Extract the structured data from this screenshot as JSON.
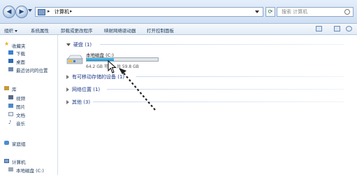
{
  "address": {
    "crumb": "计算机",
    "search_placeholder": "搜索 计算机"
  },
  "toolbar": {
    "items": [
      "组织",
      "系统属性",
      "卸载或更改程序",
      "映射网络驱动器",
      "打开控制面板"
    ]
  },
  "nav": {
    "favorites": "收藏夹",
    "downloads": "下载",
    "desktop": "桌面",
    "recent": "最近访问的位置",
    "libraries": "库",
    "videos": "视频",
    "pictures": "图片",
    "documents": "文档",
    "music": "音乐",
    "homegroup": "家庭组",
    "computer": "计算机",
    "local_disk": "本地磁盘 (C:)"
  },
  "content": {
    "hdd_group": "硬盘 (1)",
    "drive_name": "本地磁盘 (C:)",
    "drive_space": "64.2 GB 可用，共 59.8 GB",
    "drive_used_fraction": 0.38,
    "removable_group": "有可移动存储的设备 (1)",
    "network_group": "网络位置 (1)",
    "other_group": "其他 (3)"
  },
  "colors": {
    "accent": "#1e3a8a",
    "bar_fill": "#1f8fc8"
  }
}
